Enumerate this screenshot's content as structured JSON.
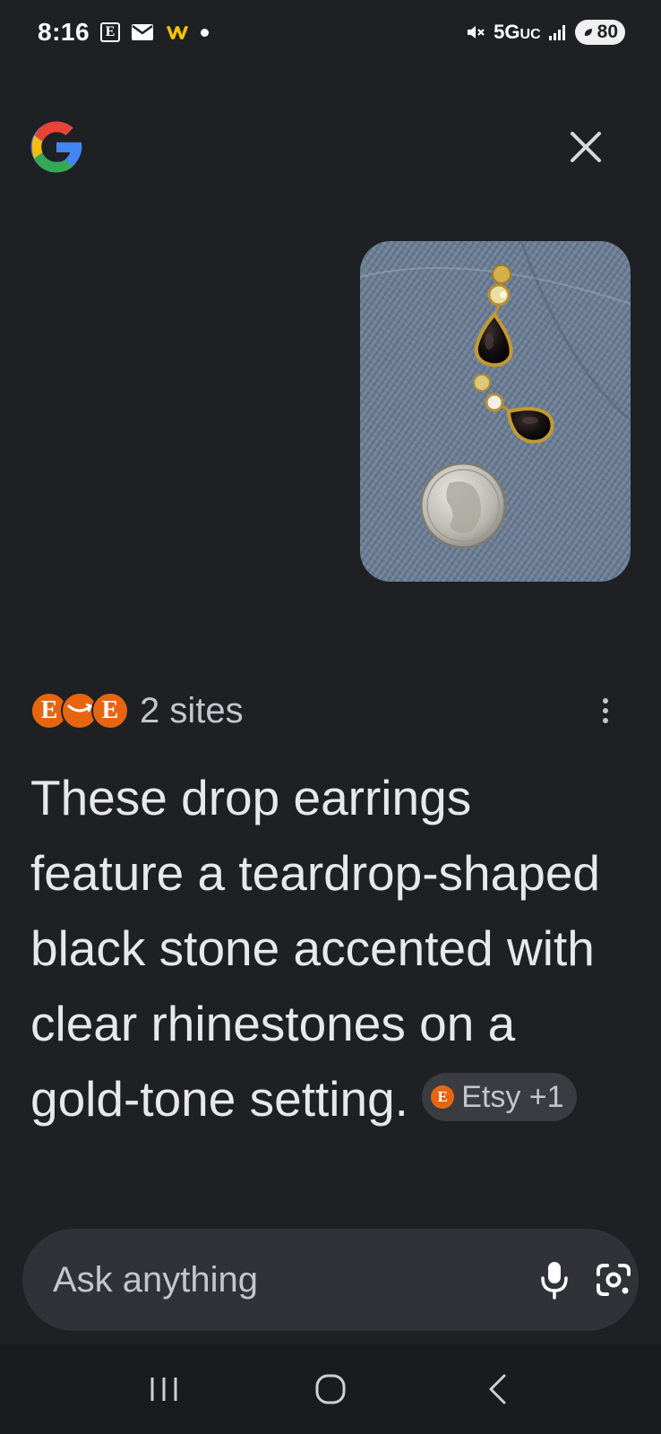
{
  "status_bar": {
    "time": "8:16",
    "network": "5G",
    "network_suffix": "UC",
    "battery": "80",
    "icons": [
      "etsy-notification-icon",
      "mail-icon",
      "wattpad-icon",
      "notification-dot",
      "mute-icon",
      "signal-icon"
    ]
  },
  "header": {
    "logo": "google-g-logo",
    "close_icon": "close-icon"
  },
  "query_image": {
    "description_icon": "photo"
  },
  "sources": {
    "count_label": "2 sites",
    "favicons": [
      "E",
      "amazon",
      "E"
    ],
    "menu_icon": "more-vert-icon"
  },
  "answer": {
    "text": "These drop earrings feature a teardrop-shaped black stone accented with clear rhinestones on a gold-tone setting.",
    "citation": {
      "favicon": "E",
      "label": "Etsy +1"
    }
  },
  "ask_bar": {
    "placeholder": "Ask anything",
    "mic_icon": "microphone-icon",
    "lens_icon": "google-lens-icon"
  },
  "nav_bar": {
    "icons": [
      "recents-icon",
      "home-icon",
      "back-icon"
    ]
  },
  "colors": {
    "background": "#1f2024",
    "surface": "#303238",
    "accent_favicon": "#e8650f",
    "text": "#e8e8ec",
    "muted_text": "#c4c6cc"
  }
}
